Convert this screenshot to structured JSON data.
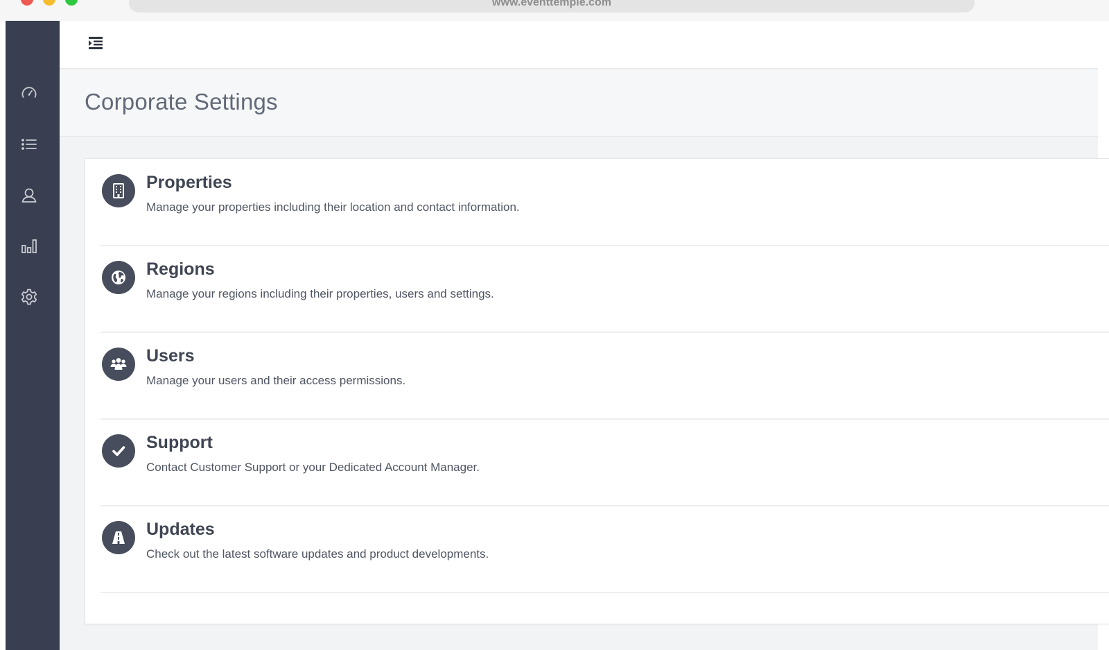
{
  "browser": {
    "url": "www.eventtemple.com"
  },
  "sidebar": {
    "items": [
      {
        "icon": "dashboard-gauge-icon",
        "label": "Dashboard"
      },
      {
        "icon": "list-icon",
        "label": "List"
      },
      {
        "icon": "user-icon",
        "label": "Users"
      },
      {
        "icon": "bar-chart-icon",
        "label": "Reports"
      },
      {
        "icon": "gear-icon",
        "label": "Settings"
      }
    ]
  },
  "header": {
    "toggle_icon": "menu-toggle-icon"
  },
  "page": {
    "title": "Corporate Settings"
  },
  "settings": [
    {
      "title": "Properties",
      "description": "Manage your properties including their location and contact information.",
      "icon": "building-icon"
    },
    {
      "title": "Regions",
      "description": "Manage your regions including their properties, users and settings.",
      "icon": "globe-icon"
    },
    {
      "title": "Users",
      "description": "Manage your users and their access permissions.",
      "icon": "users-group-icon"
    },
    {
      "title": "Support",
      "description": "Contact Customer Support or your Dedicated Account Manager.",
      "icon": "checkmark-icon"
    },
    {
      "title": "Updates",
      "description": "Check out the latest software updates and product developments.",
      "icon": "road-icon"
    }
  ],
  "colors": {
    "sidebar": "#393e50",
    "icon_circle": "#474d5c",
    "title_text": "#3f4552",
    "page_background": "#f1f3f4"
  }
}
